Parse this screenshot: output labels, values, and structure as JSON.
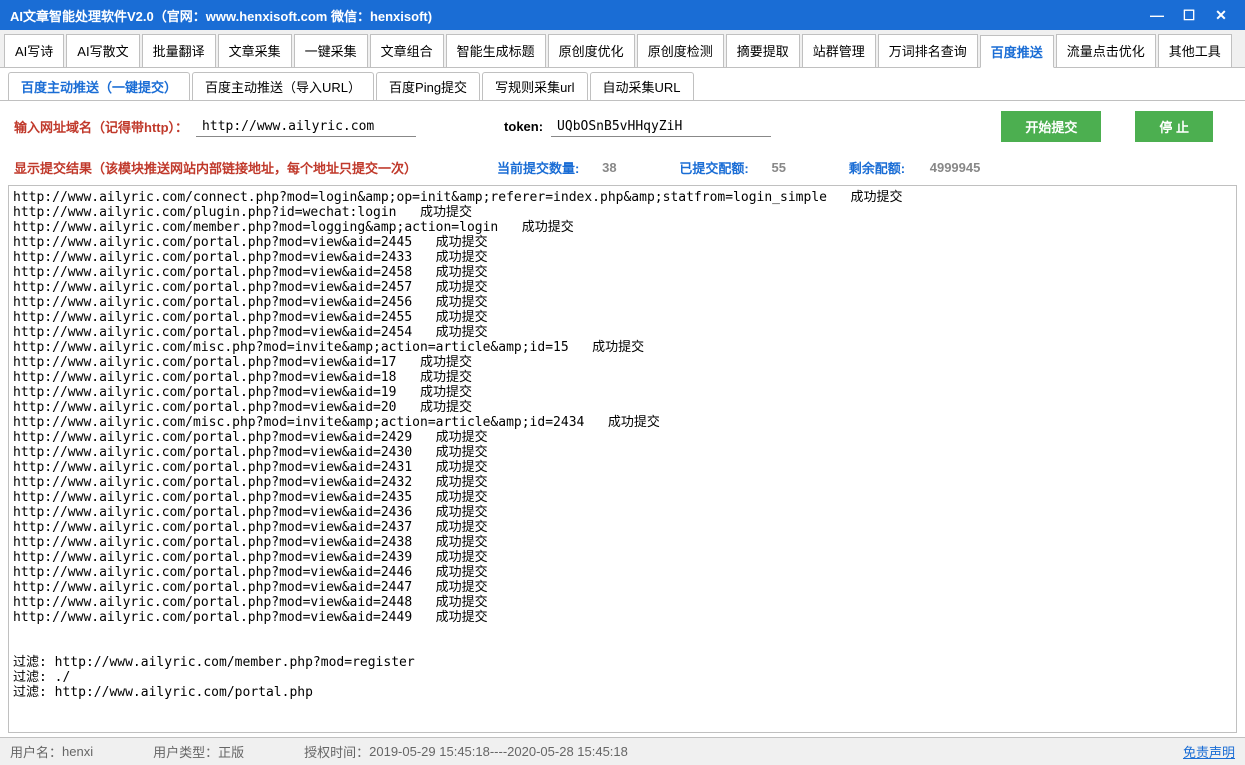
{
  "titlebar": {
    "text": "AI文章智能处理软件V2.0（官网：www.henxisoft.com  微信：henxisoft)"
  },
  "mainTabs": [
    "AI写诗",
    "AI写散文",
    "批量翻译",
    "文章采集",
    "一键采集",
    "文章组合",
    "智能生成标题",
    "原创度优化",
    "原创度检测",
    "摘要提取",
    "站群管理",
    "万词排名查询",
    "百度推送",
    "流量点击优化",
    "其他工具"
  ],
  "mainTabActive": 12,
  "subTabs": [
    "百度主动推送（一键提交）",
    "百度主动推送（导入URL）",
    "百度Ping提交",
    "写规则采集url",
    "自动采集URL"
  ],
  "subTabActive": 0,
  "form": {
    "domainLabel": "输入网址域名（记得带http）：",
    "domainValue": "http://www.ailyric.com",
    "tokenLabel": "token:",
    "tokenValue": "UQbOSnB5vHHqyZiH",
    "startBtn": "开始提交",
    "stopBtn": "停  止"
  },
  "stats": {
    "resultLabel": "显示提交结果（该模块推送网站内部链接地址，每个地址只提交一次）",
    "currentLabel": "当前提交数量:",
    "currentValue": "38",
    "submittedLabel": "已提交配额:",
    "submittedValue": "55",
    "remainLabel": "剩余配额:",
    "remainValue": "4999945"
  },
  "log": "http://www.ailyric.com/connect.php?mod=login&amp;op=init&amp;referer=index.php&amp;statfrom=login_simple   成功提交\nhttp://www.ailyric.com/plugin.php?id=wechat:login   成功提交\nhttp://www.ailyric.com/member.php?mod=logging&amp;action=login   成功提交\nhttp://www.ailyric.com/portal.php?mod=view&aid=2445   成功提交\nhttp://www.ailyric.com/portal.php?mod=view&aid=2433   成功提交\nhttp://www.ailyric.com/portal.php?mod=view&aid=2458   成功提交\nhttp://www.ailyric.com/portal.php?mod=view&aid=2457   成功提交\nhttp://www.ailyric.com/portal.php?mod=view&aid=2456   成功提交\nhttp://www.ailyric.com/portal.php?mod=view&aid=2455   成功提交\nhttp://www.ailyric.com/portal.php?mod=view&aid=2454   成功提交\nhttp://www.ailyric.com/misc.php?mod=invite&amp;action=article&amp;id=15   成功提交\nhttp://www.ailyric.com/portal.php?mod=view&aid=17   成功提交\nhttp://www.ailyric.com/portal.php?mod=view&aid=18   成功提交\nhttp://www.ailyric.com/portal.php?mod=view&aid=19   成功提交\nhttp://www.ailyric.com/portal.php?mod=view&aid=20   成功提交\nhttp://www.ailyric.com/misc.php?mod=invite&amp;action=article&amp;id=2434   成功提交\nhttp://www.ailyric.com/portal.php?mod=view&aid=2429   成功提交\nhttp://www.ailyric.com/portal.php?mod=view&aid=2430   成功提交\nhttp://www.ailyric.com/portal.php?mod=view&aid=2431   成功提交\nhttp://www.ailyric.com/portal.php?mod=view&aid=2432   成功提交\nhttp://www.ailyric.com/portal.php?mod=view&aid=2435   成功提交\nhttp://www.ailyric.com/portal.php?mod=view&aid=2436   成功提交\nhttp://www.ailyric.com/portal.php?mod=view&aid=2437   成功提交\nhttp://www.ailyric.com/portal.php?mod=view&aid=2438   成功提交\nhttp://www.ailyric.com/portal.php?mod=view&aid=2439   成功提交\nhttp://www.ailyric.com/portal.php?mod=view&aid=2446   成功提交\nhttp://www.ailyric.com/portal.php?mod=view&aid=2447   成功提交\nhttp://www.ailyric.com/portal.php?mod=view&aid=2448   成功提交\nhttp://www.ailyric.com/portal.php?mod=view&aid=2449   成功提交\n\n\n过滤: http://www.ailyric.com/member.php?mod=register\n过滤: ./\n过滤: http://www.ailyric.com/portal.php",
  "statusbar": {
    "userLabel": "用户名：",
    "userValue": "henxi",
    "typeLabel": "用户类型：",
    "typeValue": "正版",
    "authLabel": "授权时间：",
    "authValue": "2019-05-29 15:45:18----2020-05-28 15:45:18",
    "disclaimer": "免责声明"
  }
}
